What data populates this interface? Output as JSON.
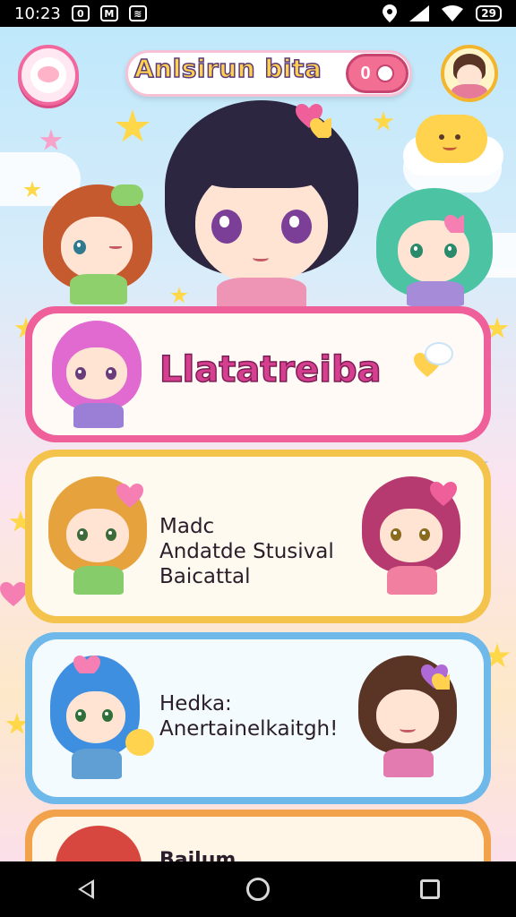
{
  "status_bar": {
    "time": "10:23",
    "badge_a": "0",
    "badge_b": "M",
    "badge_c": "≋",
    "battery": "29",
    "icons": [
      "location-icon",
      "signal-icon",
      "wifi-icon",
      "battery-icon"
    ]
  },
  "header": {
    "title": "Anlsirun bita",
    "coin_count": "0",
    "logo_icon": "bunny-logo-icon",
    "avatar_icon": "profile-avatar-icon"
  },
  "cards": [
    {
      "title": "Llatatreiba",
      "title_color": "#d63f8f"
    },
    {
      "line1": "Madc",
      "line2": "Andatde Stusival",
      "line3": "Baicattal"
    },
    {
      "line1": "Hedka:",
      "line2": "Anertainelkaitgh!"
    },
    {
      "title": "Bailum"
    }
  ],
  "colors": {
    "pink_border": "#ef5f9a",
    "gold_border": "#f4c34c",
    "blue_border": "#6fb8ea",
    "orange_border": "#f2a24a"
  },
  "navigation": {
    "back": "back-icon",
    "home": "home-icon",
    "recents": "recents-icon"
  }
}
